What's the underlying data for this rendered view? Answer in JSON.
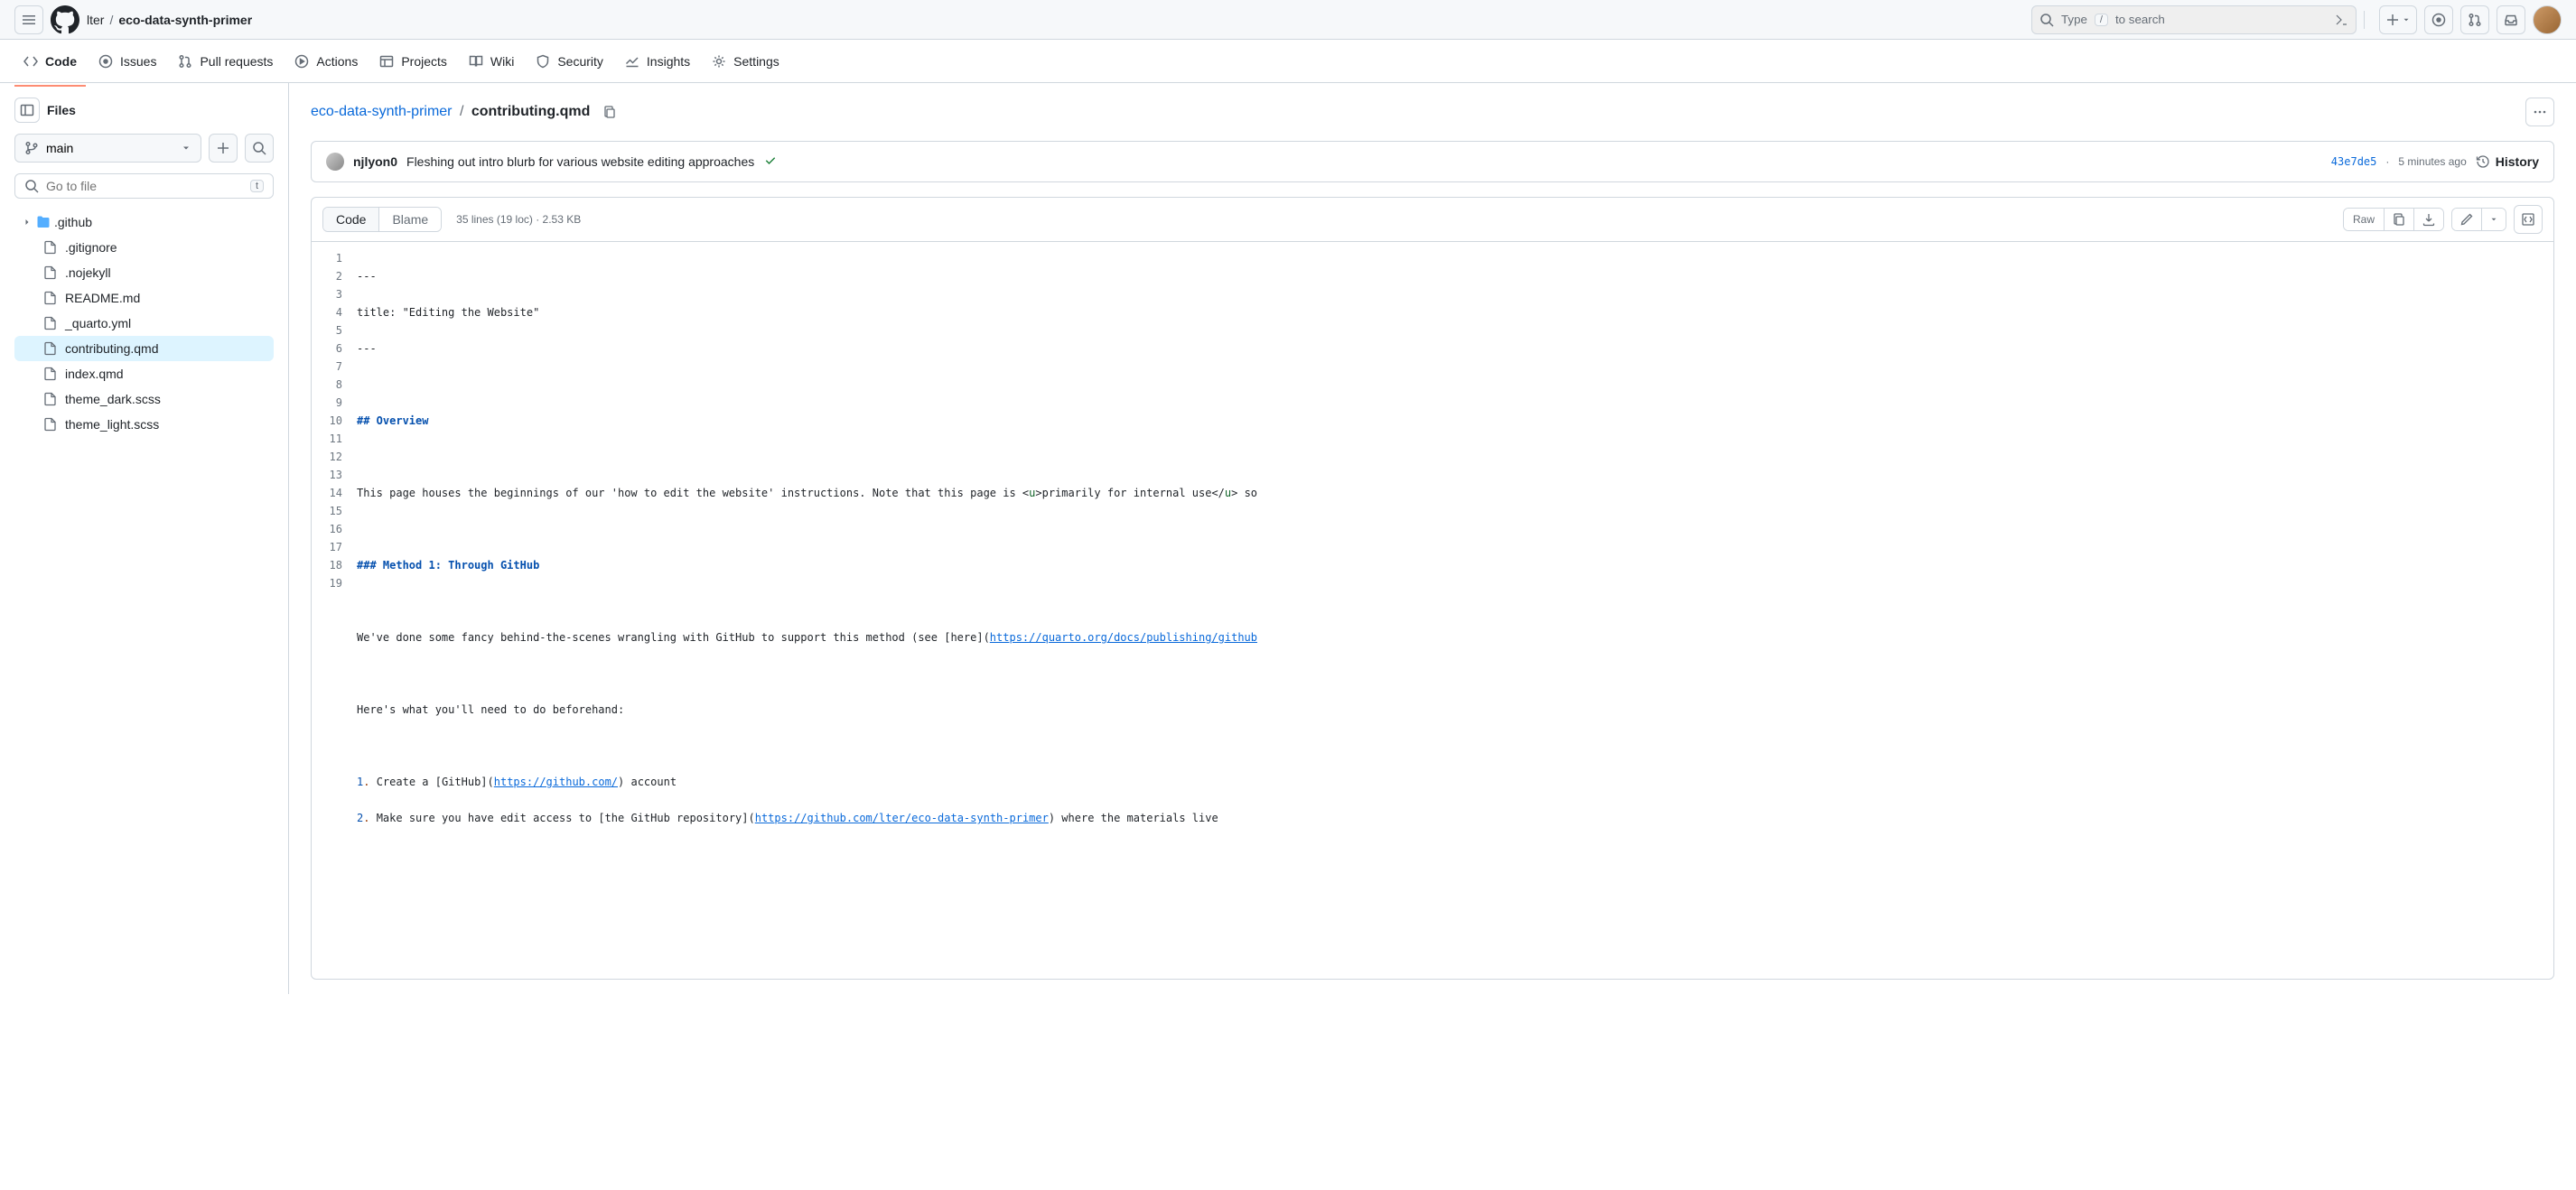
{
  "header": {
    "owner": "lter",
    "repo": "eco-data-synth-primer",
    "search_label_prefix": "Type",
    "search_label_suffix": "to search"
  },
  "repo_nav": {
    "code": "Code",
    "issues": "Issues",
    "pulls": "Pull requests",
    "actions": "Actions",
    "projects": "Projects",
    "wiki": "Wiki",
    "security": "Security",
    "insights": "Insights",
    "settings": "Settings"
  },
  "sidebar": {
    "title": "Files",
    "branch": "main",
    "file_search_placeholder": "Go to file",
    "file_search_kbd": "t",
    "tree": {
      "folder": ".github",
      "files": [
        ".gitignore",
        ".nojekyll",
        "README.md",
        "_quarto.yml",
        "contributing.qmd",
        "index.qmd",
        "theme_dark.scss",
        "theme_light.scss"
      ]
    }
  },
  "breadcrumb": {
    "repo": "eco-data-synth-primer",
    "file": "contributing.qmd"
  },
  "commit": {
    "author": "njlyon0",
    "message": "Fleshing out intro blurb for various website editing approaches",
    "sha": "43e7de5",
    "time": "5 minutes ago",
    "history_label": "History"
  },
  "toolbar": {
    "code_tab": "Code",
    "blame_tab": "Blame",
    "file_info": "35 lines (19 loc) · 2.53 KB",
    "raw": "Raw"
  },
  "code": {
    "line1": "---",
    "line2": "title: \"Editing the Website\"",
    "line3": "---",
    "line4": "",
    "line5": "## Overview",
    "line6": "",
    "line7_a": "This page houses the beginnings of our 'how to edit the website' instructions. Note that this page is <",
    "line7_b": "u",
    "line7_c": ">primarily for internal use</",
    "line7_d": "u",
    "line7_e": "> so",
    "line8": "",
    "line9": "### Method 1: Through GitHub",
    "line10": "",
    "line11_a": "We've done some fancy behind-the-scenes wrangling with GitHub to support this method (see [here](",
    "line11_b": "https://quarto.org/docs/publishing/github",
    "line12": "",
    "line13": "Here's what you'll need to do beforehand:",
    "line14": "",
    "line15_num": "1",
    "line15_dot": ".",
    "line15_a": " Create a [GitHub](",
    "line15_b": "https://github.com/",
    "line15_c": ") account",
    "line16_num": "2",
    "line16_dot": ".",
    "line16_a": " Make sure you have edit access to [the GitHub repository](",
    "line16_b": "https://github.com/lter/eco-data-synth-primer",
    "line16_c": ") where the materials live",
    "line17": "",
    "line18": "",
    "line19": ""
  }
}
